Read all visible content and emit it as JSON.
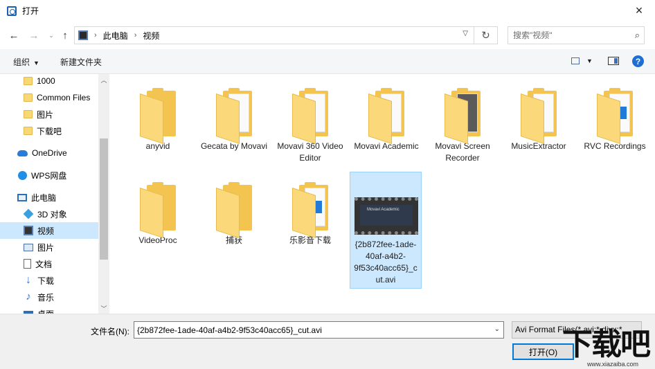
{
  "window": {
    "title": "打开",
    "close_icon": "×"
  },
  "nav": {
    "breadcrumbs": [
      "此电脑",
      "视频"
    ],
    "search_placeholder": "搜索\"视频\""
  },
  "toolbar": {
    "organize": "组织",
    "new_folder": "新建文件夹",
    "help": "?"
  },
  "sidebar": {
    "items": [
      {
        "label": "1000",
        "icon": "folder-icon"
      },
      {
        "label": "Common Files",
        "icon": "folder-icon"
      },
      {
        "label": "图片",
        "icon": "folder-icon"
      },
      {
        "label": "下载吧",
        "icon": "folder-icon"
      },
      {
        "label": "OneDrive",
        "icon": "cloud-icon"
      },
      {
        "label": "WPS网盘",
        "icon": "wps-cloud-icon"
      },
      {
        "label": "此电脑",
        "icon": "computer-icon"
      },
      {
        "label": "3D 对象",
        "icon": "cube-icon"
      },
      {
        "label": "视频",
        "icon": "video-folder-icon",
        "selected": true
      },
      {
        "label": "图片",
        "icon": "pictures-icon"
      },
      {
        "label": "文档",
        "icon": "documents-icon"
      },
      {
        "label": "下载",
        "icon": "download-icon"
      },
      {
        "label": "音乐",
        "icon": "music-icon"
      },
      {
        "label": "桌面",
        "icon": "desktop-icon"
      }
    ]
  },
  "files": [
    {
      "name": "anyvid",
      "type": "folder"
    },
    {
      "name": "Gecata by Movavi",
      "type": "folder-doc"
    },
    {
      "name": "Movavi 360 Video Editor",
      "type": "folder-doc"
    },
    {
      "name": "Movavi Academic",
      "type": "folder-doc"
    },
    {
      "name": "Movavi Screen Recorder",
      "type": "folder-dark"
    },
    {
      "name": "MusicExtractor",
      "type": "folder-doc"
    },
    {
      "name": "RVC Recordings",
      "type": "folder-blue"
    },
    {
      "name": "VideoProc",
      "type": "folder"
    },
    {
      "name": "捕获",
      "type": "folder"
    },
    {
      "name": "乐影音下载",
      "type": "folder-blue"
    },
    {
      "name": "{2b872fee-1ade-40af-a4b2-9f53c40acc65}_cut.avi",
      "type": "video",
      "selected": true,
      "thumb_caption": "Movavi Academic"
    }
  ],
  "footer": {
    "filename_label": "文件名(N):",
    "filename_value": "{2b872fee-1ade-40af-a4b2-9f53c40acc65}_cut.avi",
    "filetype": "Avi Format Files(*.avi;*.divx;*",
    "open_button": "打开(O)"
  },
  "watermark": {
    "text": "下载吧",
    "url": "www.xiazaiba.com"
  }
}
